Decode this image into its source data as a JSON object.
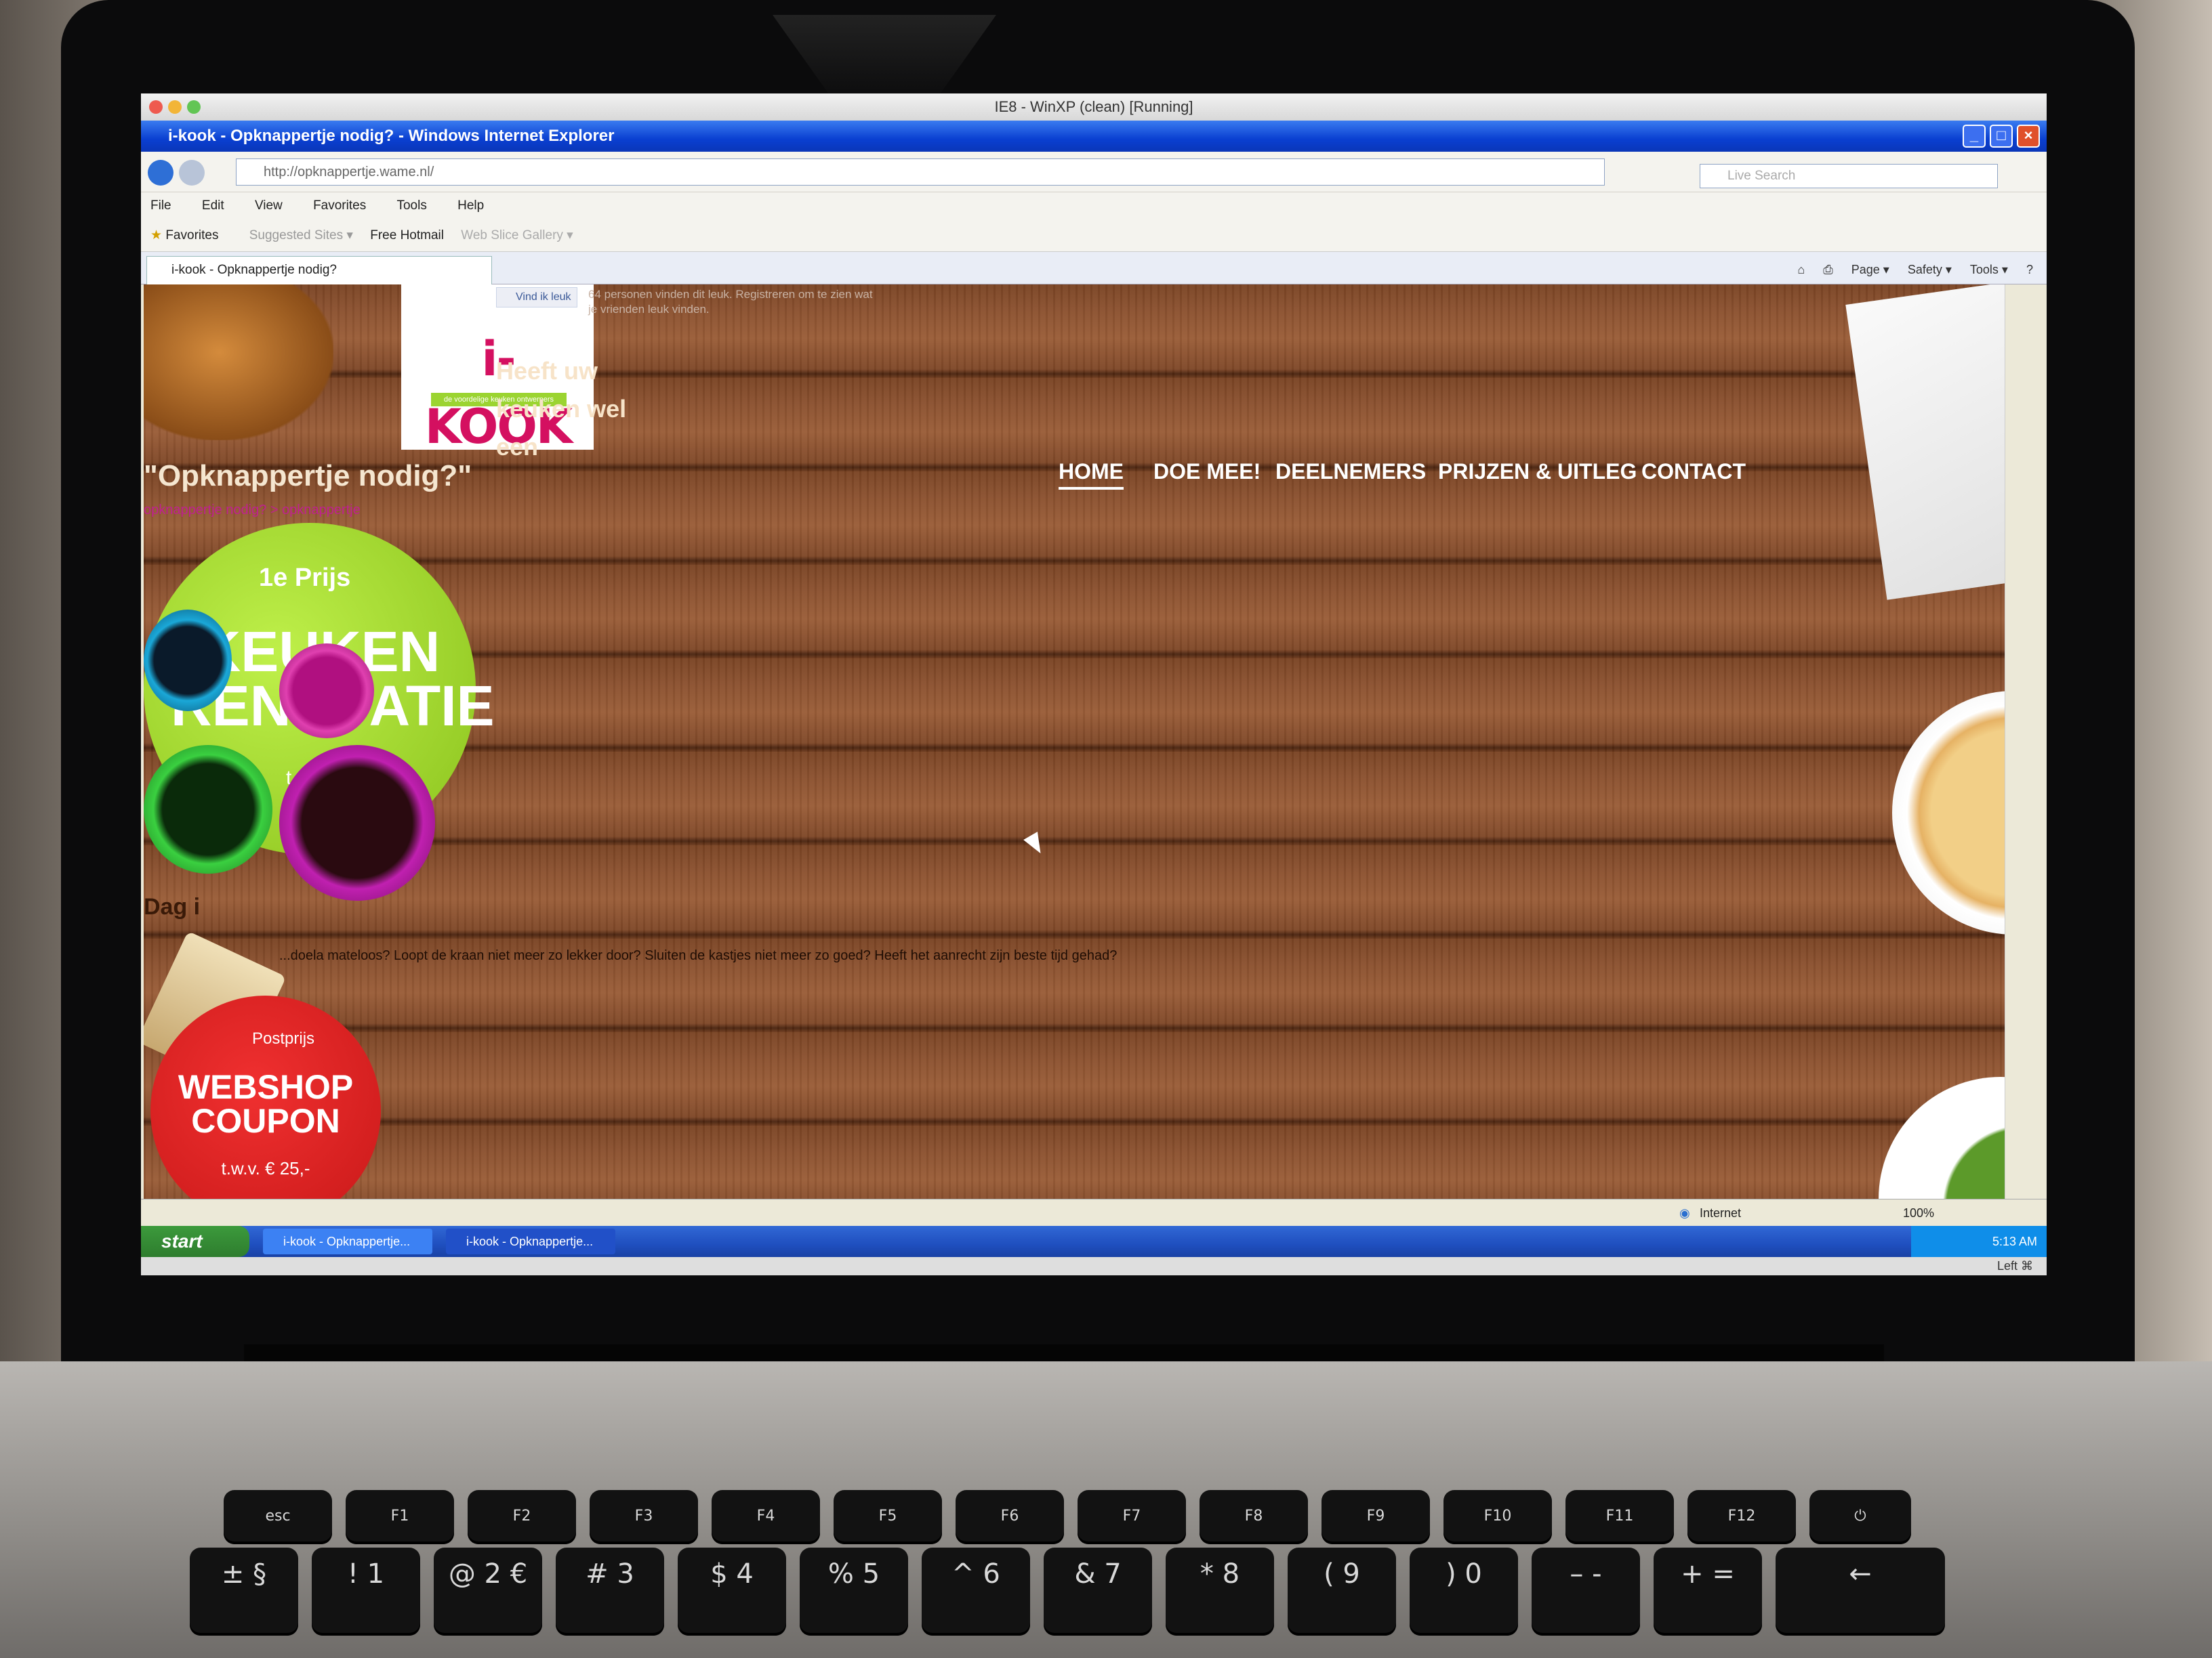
{
  "vm_window": {
    "title": "IE8 - WinXP (clean) [Running]"
  },
  "ie": {
    "window_title": "i-kook - Opknappertje nodig? - Windows Internet Explorer",
    "address": "http://opknappertje.wame.nl/",
    "search_placeholder": "Live Search",
    "menu": [
      "File",
      "Edit",
      "View",
      "Favorites",
      "Tools",
      "Help"
    ],
    "favorites_bar": {
      "favorites": "Favorites",
      "suggested": "Suggested Sites ▾",
      "hotmail": "Free Hotmail",
      "webslice": "Web Slice Gallery ▾"
    },
    "tab_title": "i-kook - Opknappertje nodig?",
    "command_bar": [
      "Page ▾",
      "Safety ▾",
      "Tools ▾"
    ]
  },
  "site": {
    "logo": "i-KOOK",
    "logo_subtitle": "de voordelige keuken ontwerpers",
    "fb_like": "Vind ik leuk",
    "fb_text": "64 personen vinden dit leuk. Registreren om te zien wat je vrienden leuk vinden.",
    "slogan": "Heeft uw keuken wel een",
    "page_title": "\"Opknappertje nodig?\"",
    "breadcrumb": "opknappertje nodig? > opknappertje",
    "nav": [
      "HOME",
      "DOE MEE!",
      "DEELNEMERS",
      "PRIJZEN & UITLEG",
      "CONTACT"
    ],
    "intro_heading": "Dag i",
    "intro_text": "...doela mateloos? Loopt de kraan niet meer zo lekker door? Sluiten de kastjes niet meer zo goed? Heeft het aanrecht zijn beste tijd gehad?",
    "prize_label": "1e Prijs",
    "prize_main": "KEUKEN RENOVATIE",
    "prize_small": "t.w.v.",
    "coupon_tag": "Postprijs",
    "coupon_title": "WEBSHOP COUPON",
    "coupon_value": "t.w.v. € 25,-"
  },
  "status": {
    "zone": "Internet",
    "zoom": "100%"
  },
  "taskbar": {
    "start": "start",
    "tasks": [
      "i-kook - Opknappertje...",
      "i-kook - Opknappertje..."
    ],
    "time": "5:13 AM"
  },
  "host_bar": {
    "text": "Left ⌘"
  },
  "keyboard": {
    "fn_row": [
      "esc",
      "F1",
      "F2",
      "F3",
      "F4",
      "F5",
      "F6",
      "F7",
      "F8",
      "F9",
      "F10",
      "F11",
      "F12",
      "⏻"
    ],
    "num_row": [
      "± §",
      "! 1",
      "@ 2 €",
      "# 3",
      "$ 4",
      "% 5",
      "^ 6",
      "& 7",
      "* 8",
      "( 9",
      ") 0",
      "– -",
      "+ =",
      "←"
    ]
  },
  "colors": {
    "ie_title": "#0a3fd1",
    "nav_text": "#ffffff",
    "logo_pink": "#d41060",
    "prize_green": "#8ac21c",
    "coupon_red": "#c81818",
    "wood": "#8c5230"
  }
}
